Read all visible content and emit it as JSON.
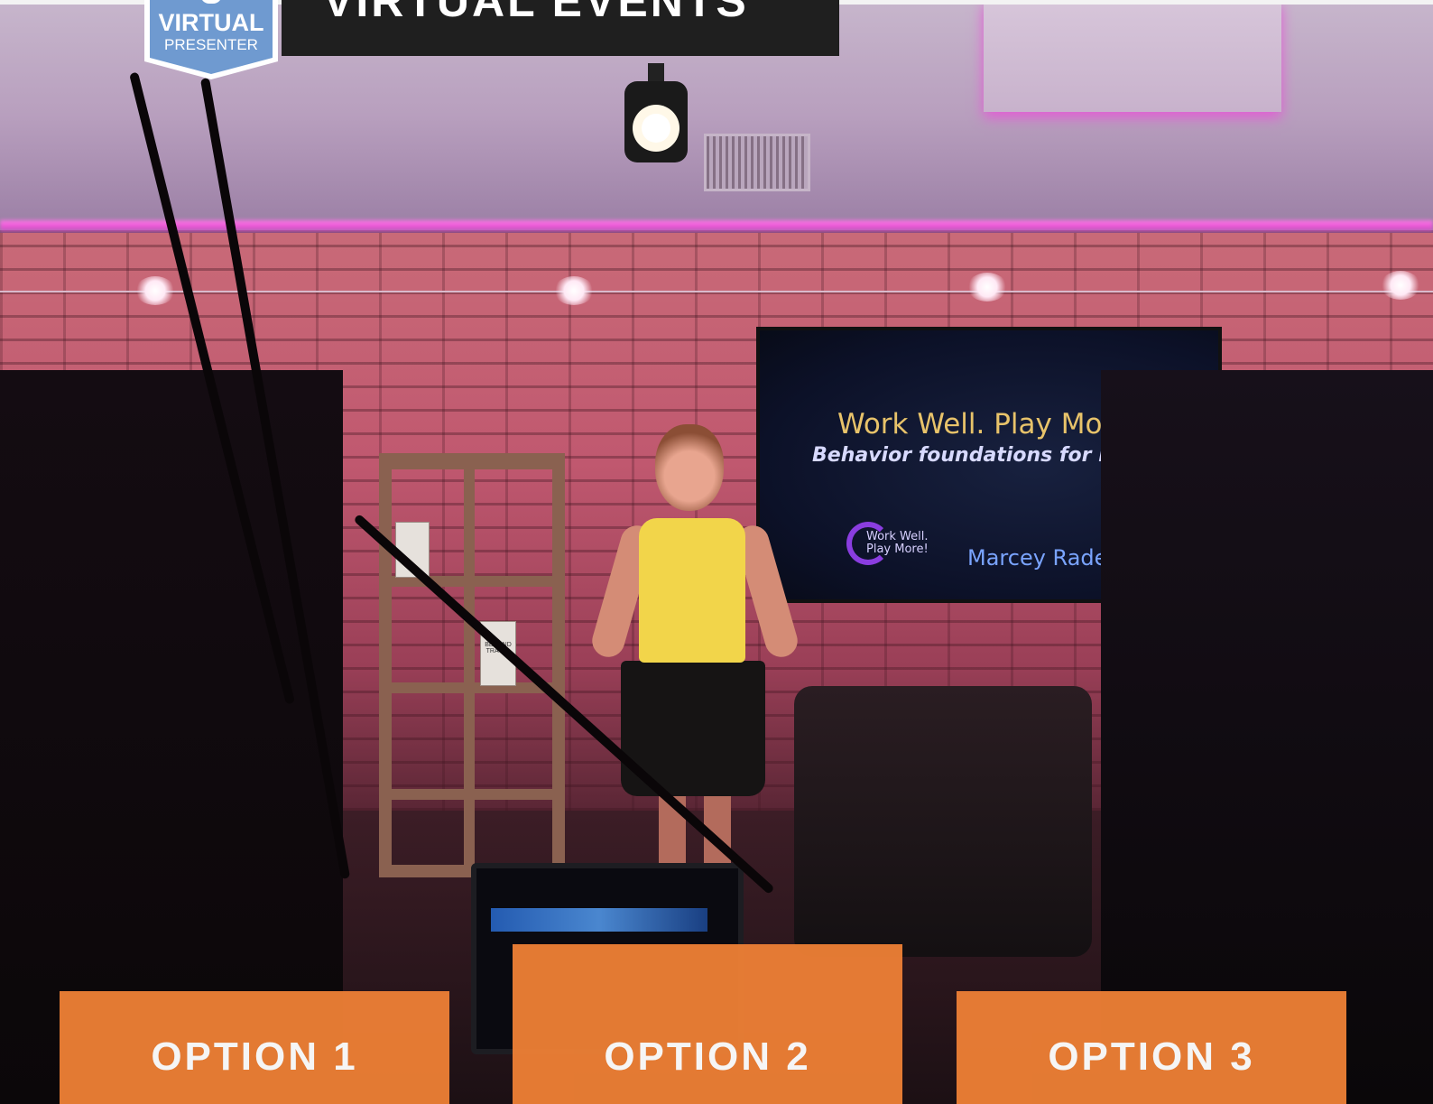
{
  "header": {
    "title": "VIRTUAL EVENTS"
  },
  "badge": {
    "line1": "VIRTUAL",
    "line2": "PRESENTER",
    "color": "#6f9ad0"
  },
  "screen": {
    "title": "Work Well. Play Mor",
    "subtitle": "Behavior foundations for better h",
    "logo_left_line1": "Work Well.",
    "logo_left_line2": "Play More!",
    "logo_right": "Marcey Rade"
  },
  "books": {
    "book_label": "BEYOND TRAVEL"
  },
  "options": [
    {
      "label": "OPTION 1"
    },
    {
      "label": "OPTION 2"
    },
    {
      "label": "OPTION 3"
    }
  ],
  "colors": {
    "option_bg": "#ec7f35",
    "header_bg": "#1f1f1f",
    "accent_pink": "#e14dd0"
  }
}
